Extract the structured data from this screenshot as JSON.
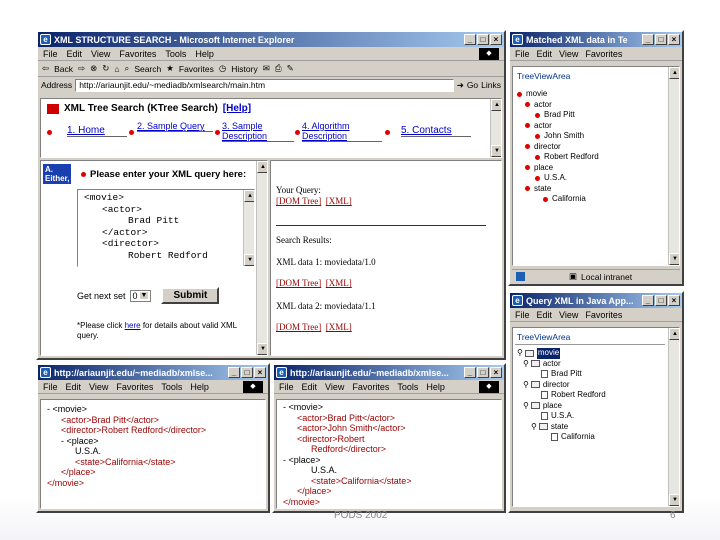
{
  "main_window": {
    "title": "XML STRUCTURE SEARCH - Microsoft Internet Explorer",
    "menu": [
      "File",
      "Edit",
      "View",
      "Favorites",
      "Tools",
      "Help"
    ],
    "toolbar": [
      "Back",
      "Search",
      "Favorites",
      "History"
    ],
    "address_label": "Address",
    "address_url": "http://ariaunjit.edu/~mediadb/xmlsearch/main.htm",
    "go_label": "Go",
    "links_label": "Links",
    "page_title": "XML Tree Search (KTree Search)",
    "help_link": "[Help]",
    "nav": [
      "1. Home",
      "2. Sample Query",
      "3. Sample Description",
      "4. Algorithm Description",
      "5. Contacts"
    ],
    "left_frame": {
      "corner_label_1": "A.",
      "corner_label_2": "Either,",
      "prompt": "Please enter your XML query here:",
      "query_lines": [
        "<movie>",
        "<actor>",
        "Brad Pitt",
        "</actor>",
        "<director>",
        "Robert Redford"
      ],
      "get_next_label": "Get next set",
      "get_next_value": "0",
      "submit_label": "Submit",
      "note_pre": "*Please click ",
      "note_link": "here",
      "note_post": " for details about valid XML query."
    },
    "right_frame": {
      "your_query_label": "Your Query:",
      "dom_tree_link": "[DOM Tree]",
      "xml_link": "[XML]",
      "search_results_label": "Search Results:",
      "results": [
        "XML data 1: moviedata/1.0",
        "XML data 2: moviedata/1.1"
      ]
    }
  },
  "tree_window_top": {
    "title": "Matched XML data in Te",
    "menu": [
      "File",
      "Edit",
      "View",
      "Favorites"
    ],
    "panel_label": "TreeViewArea",
    "nodes": [
      {
        "label": "movie",
        "indent": 0
      },
      {
        "label": "actor",
        "indent": 1
      },
      {
        "label": "Brad Pitt",
        "indent": 2
      },
      {
        "label": "actor",
        "indent": 1
      },
      {
        "label": "John Smith",
        "indent": 2
      },
      {
        "label": "director",
        "indent": 1
      },
      {
        "label": "Robert Redford",
        "indent": 2
      },
      {
        "label": "place",
        "indent": 1
      },
      {
        "label": "U.S.A.",
        "indent": 2
      },
      {
        "label": "state",
        "indent": 1
      },
      {
        "label": "California",
        "indent": 3
      }
    ],
    "status": "Local intranet"
  },
  "tree_window_bottom": {
    "title": "Query XML in Java App...",
    "menu": [
      "File",
      "Edit",
      "View",
      "Favorites"
    ],
    "panel_label": "TreeViewArea",
    "nodes": [
      {
        "label": "movie",
        "indent": 0,
        "kind": "folder"
      },
      {
        "label": "actor",
        "indent": 1,
        "kind": "folder"
      },
      {
        "label": "Brad Pitt",
        "indent": 2,
        "kind": "doc"
      },
      {
        "label": "director",
        "indent": 1,
        "kind": "folder"
      },
      {
        "label": "Robert Redford",
        "indent": 2,
        "kind": "doc"
      },
      {
        "label": "place",
        "indent": 1,
        "kind": "folder"
      },
      {
        "label": "U.S.A.",
        "indent": 2,
        "kind": "doc"
      },
      {
        "label": "state",
        "indent": 2,
        "kind": "folder"
      },
      {
        "label": "California",
        "indent": 3,
        "kind": "doc"
      }
    ]
  },
  "xml_window_left": {
    "title": "http://ariaunjit.edu/~mediadb/xmlse...",
    "menu": [
      "File",
      "Edit",
      "View",
      "Favorites",
      "Tools",
      "Help"
    ],
    "lines": [
      {
        "text": "- <movie>",
        "indent": 0
      },
      {
        "text": "<actor>Brad Pitt</actor>",
        "indent": 1
      },
      {
        "text": "<director>Robert Redford</director>",
        "indent": 1
      },
      {
        "text": "- <place>",
        "indent": 1
      },
      {
        "text": "U.S.A.",
        "indent": 2
      },
      {
        "text": "<state>California</state>",
        "indent": 2
      },
      {
        "text": "</place>",
        "indent": 1
      },
      {
        "text": "</movie>",
        "indent": 0
      }
    ]
  },
  "xml_window_right": {
    "title": "http://ariaunjit.edu/~mediadb/xmlse...",
    "menu": [
      "File",
      "Edit",
      "View",
      "Favorites",
      "Tools",
      "Help"
    ],
    "lines": [
      {
        "text": "- <movie>",
        "indent": 0
      },
      {
        "text": "<actor>Brad Pitt</actor>",
        "indent": 1
      },
      {
        "text": "<actor>John Smith</actor>",
        "indent": 1
      },
      {
        "text": "<director>Robert",
        "indent": 1
      },
      {
        "text": "Redford</director>",
        "indent": 2
      },
      {
        "text": "- <place>",
        "indent": 0
      },
      {
        "text": "U.S.A.",
        "indent": 2
      },
      {
        "text": "<state>California</state>",
        "indent": 2
      },
      {
        "text": "</place>",
        "indent": 1
      },
      {
        "text": "</movie>",
        "indent": 0
      }
    ]
  },
  "footer": {
    "center": "PODS 2002",
    "page": "6"
  }
}
